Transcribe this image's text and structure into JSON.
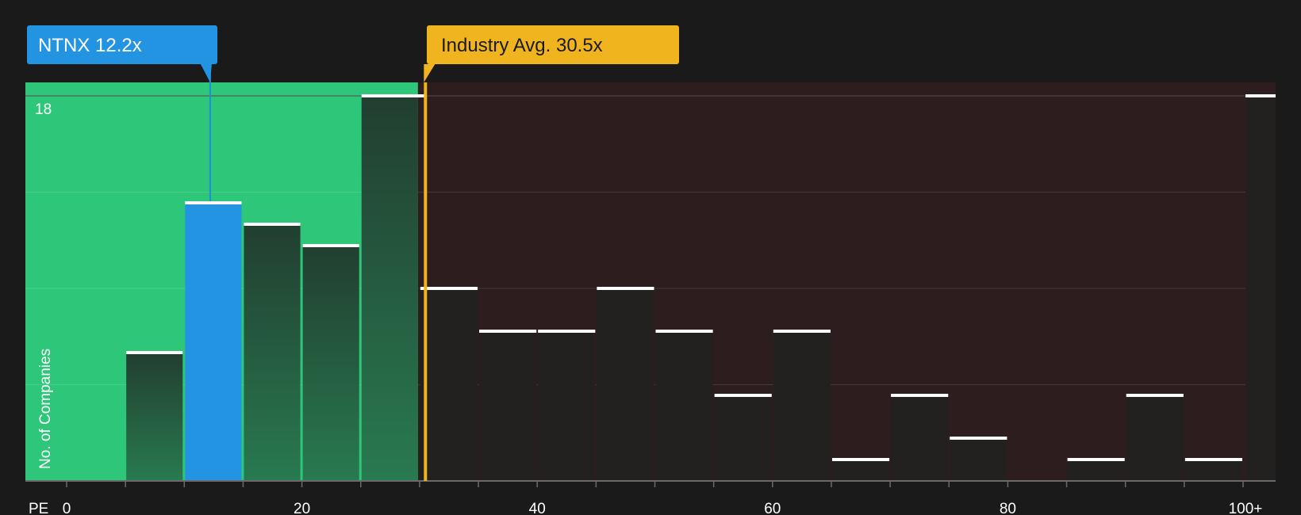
{
  "chart_data": {
    "type": "bar",
    "xlabel": "PE",
    "ylabel": "No. of Companies",
    "x_tick_labels": [
      "0",
      "20",
      "40",
      "60",
      "80",
      "100+"
    ],
    "ylim": [
      0,
      18
    ],
    "y_tick_label": "18",
    "grid": true,
    "bin_width": 5,
    "bins": [
      {
        "x0": 0,
        "x1": 5,
        "value": 0
      },
      {
        "x0": 5,
        "x1": 10,
        "value": 6
      },
      {
        "x0": 10,
        "x1": 15,
        "value": 13
      },
      {
        "x0": 15,
        "x1": 20,
        "value": 12
      },
      {
        "x0": 20,
        "x1": 25,
        "value": 11
      },
      {
        "x0": 25,
        "x1": 30,
        "value": 18
      },
      {
        "x0": 30,
        "x1": 35,
        "value": 9
      },
      {
        "x0": 35,
        "x1": 40,
        "value": 7
      },
      {
        "x0": 40,
        "x1": 45,
        "value": 7
      },
      {
        "x0": 45,
        "x1": 50,
        "value": 9
      },
      {
        "x0": 50,
        "x1": 55,
        "value": 7
      },
      {
        "x0": 55,
        "x1": 60,
        "value": 4
      },
      {
        "x0": 60,
        "x1": 65,
        "value": 7
      },
      {
        "x0": 65,
        "x1": 70,
        "value": 1
      },
      {
        "x0": 70,
        "x1": 75,
        "value": 4
      },
      {
        "x0": 75,
        "x1": 80,
        "value": 2
      },
      {
        "x0": 80,
        "x1": 85,
        "value": 0
      },
      {
        "x0": 85,
        "x1": 90,
        "value": 1
      },
      {
        "x0": 90,
        "x1": 95,
        "value": 4
      },
      {
        "x0": 95,
        "x1": 100,
        "value": 1
      },
      {
        "x0": 100,
        "x1": null,
        "value": 18
      }
    ],
    "company": {
      "ticker": "NTNX",
      "value": 12.2,
      "label": "NTNX 12.2x",
      "bin_index": 2
    },
    "industry_avg": {
      "value": 30.5,
      "label": "Industry Avg. 30.5x"
    },
    "colors": {
      "background": "#1a1a1a",
      "green_zone": "#2ec77a",
      "red_zone": "#2e1d1e",
      "company_bar": "#2394e2",
      "company_callout": "#2394e2",
      "industry_line": "#f0b51e",
      "green_bar_top": "#223e30",
      "green_bar_bottom": "#287a50",
      "dark_bar": "#232020",
      "cap": "#ffffff",
      "grid": "#4a3c3c"
    }
  }
}
